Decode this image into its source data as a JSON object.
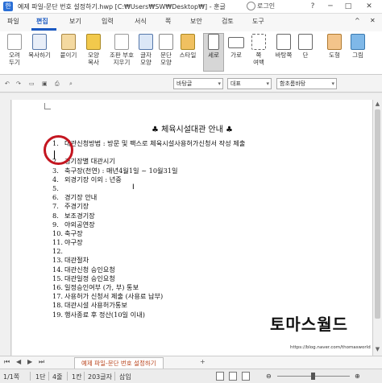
{
  "window": {
    "title": "예제 파일-문단 번호 설정하기.hwp [C:₩Users₩SW₩Desktop₩] - 훈글",
    "login": "로그인",
    "buttons": [
      "?",
      "─",
      "□",
      "✕"
    ]
  },
  "menu": {
    "items": [
      "파일",
      "편집",
      "보기",
      "입력",
      "서식",
      "쪽",
      "보안",
      "검토",
      "도구"
    ],
    "active": "편집",
    "collapse": "^",
    "close_doc": "✕"
  },
  "ribbon": {
    "buttons": [
      {
        "label": "오려\n두기",
        "icon": "scissors-icon"
      },
      {
        "label": "복사하기",
        "icon": "copy-icon"
      },
      {
        "label": "붙이기",
        "icon": "paste-icon"
      },
      {
        "label": "모양\n복사",
        "icon": "format-painter-icon"
      },
      {
        "label": "조판 부호\n지우기",
        "icon": "erase-codes-icon"
      },
      {
        "label": "글자\n모양",
        "icon": "char-shape-icon"
      },
      {
        "label": "문단\n모양",
        "icon": "para-shape-icon"
      },
      {
        "label": "스타일",
        "icon": "style-icon"
      },
      {
        "label": "세로",
        "icon": "portrait-icon"
      },
      {
        "label": "가로",
        "icon": "landscape-icon"
      },
      {
        "label": "쪽\n여백",
        "icon": "page-margin-icon"
      },
      {
        "label": "바탕쪽",
        "icon": "master-page-icon"
      },
      {
        "label": "단",
        "icon": "columns-icon"
      },
      {
        "label": "도형",
        "icon": "shape-icon"
      },
      {
        "label": "그림",
        "icon": "picture-icon"
      }
    ],
    "selected": "세로"
  },
  "format": {
    "style": "바탕글",
    "mode": "대표",
    "font": "함초롬바탕"
  },
  "document": {
    "title": "♣ 체육시설대관 안내 ♣",
    "lines": [
      {
        "n": "1.",
        "t": "대관신청방법 : 방문 및 팩스로 체육시설사용허가신청서 작성 제출"
      },
      {
        "n": "",
        "t": ""
      },
      {
        "n": "2.",
        "t": "경기장별 대관시기"
      },
      {
        "n": "3.",
        "t": "축구장(천연) : 매년4월1일 ~ 10월31일"
      },
      {
        "n": "4.",
        "t": "외경기장 이외 : 년중"
      },
      {
        "n": "5.",
        "t": ""
      },
      {
        "n": "6.",
        "t": "경기장 안내"
      },
      {
        "n": "7.",
        "t": "주경기장"
      },
      {
        "n": "8.",
        "t": "보조경기장"
      },
      {
        "n": "9.",
        "t": "야외공연장"
      },
      {
        "n": "10.",
        "t": "축구장"
      },
      {
        "n": "11.",
        "t": "야구장"
      },
      {
        "n": "12.",
        "t": ""
      },
      {
        "n": "13.",
        "t": "대관절차"
      },
      {
        "n": "14.",
        "t": "대관신청 승인요청"
      },
      {
        "n": "15.",
        "t": "대관일정 승인요청"
      },
      {
        "n": "16.",
        "t": "일정승인여부 (가, 부) 통보"
      },
      {
        "n": "17.",
        "t": "사용허가 신청서 제출 (사용료 납부)"
      },
      {
        "n": "18.",
        "t": "대관시설 사용허가통보"
      },
      {
        "n": "19.",
        "t": "행사종료 후 정산(10일 이내)"
      }
    ],
    "brand": "토마스월드",
    "brand_url": "https://blog.naver.com/thomasworld"
  },
  "tabbar": {
    "doc_tab": "예제 파일-문단 번호 설정하기",
    "plus": "+"
  },
  "status": {
    "page": "1/1쪽",
    "section": "1단",
    "line": "4줄",
    "col": "1칸",
    "chars": "203글자",
    "mode": "삽입"
  }
}
